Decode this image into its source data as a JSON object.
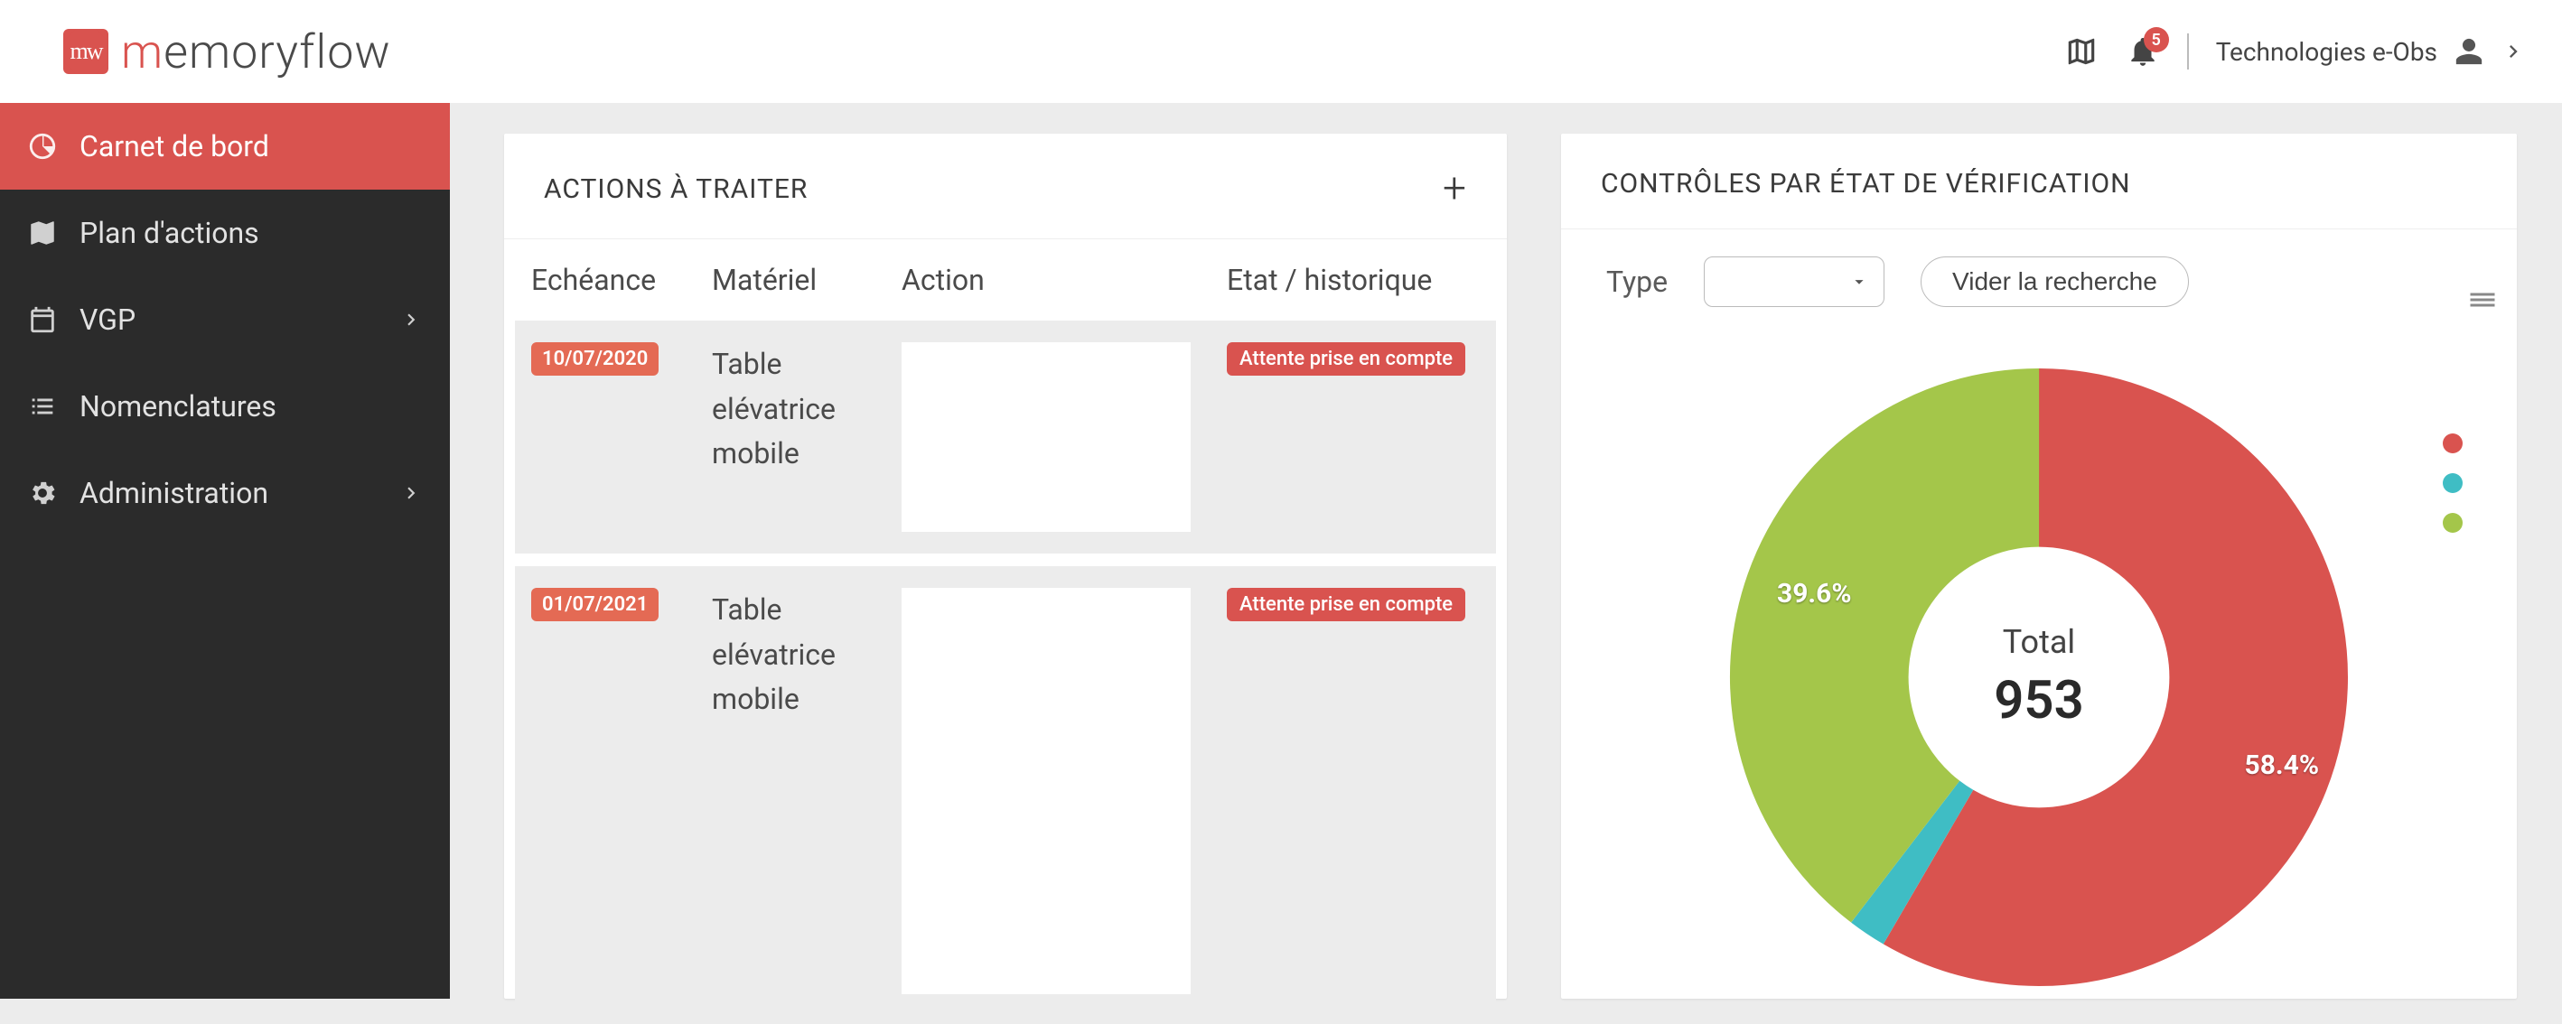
{
  "brand": {
    "name": "memoryflow",
    "badge_text": "mw"
  },
  "header": {
    "notif_count": "5",
    "account_label": "Technologies e-Obs"
  },
  "sidebar": {
    "items": [
      {
        "label": "Carnet de bord",
        "icon": "dashboard",
        "active": true
      },
      {
        "label": "Plan d'actions",
        "icon": "map"
      },
      {
        "label": "VGP",
        "icon": "calendar",
        "expandable": true
      },
      {
        "label": "Nomenclatures",
        "icon": "list"
      },
      {
        "label": "Administration",
        "icon": "gear",
        "expandable": true
      }
    ]
  },
  "actions_panel": {
    "title": "ACTIONS À TRAITER",
    "columns": {
      "c0": "Echéance",
      "c1": "Matériel",
      "c2": "Action",
      "c3": "Etat / historique"
    },
    "rows": [
      {
        "date": "10/07/2020",
        "materiel": "Table elévatrice mobile",
        "etat": "Attente prise en compte"
      },
      {
        "date": "01/07/2021",
        "materiel": "Table elévatrice mobile",
        "etat": "Attente prise en compte"
      }
    ]
  },
  "controls_panel": {
    "title": "CONTRÔLES PAR ÉTAT DE VÉRIFICATION",
    "type_label": "Type",
    "clear_label": "Vider la recherche",
    "total_label": "Total",
    "total_value": "953",
    "slice_labels": {
      "green": "39.6%",
      "red": "58.4%"
    }
  },
  "chart_data": {
    "type": "pie",
    "title": "CONTRÔLES PAR ÉTAT DE VÉRIFICATION",
    "total": 953,
    "series": [
      {
        "name": "red",
        "pct": 58.4,
        "value": 557,
        "color": "#d9534f"
      },
      {
        "name": "teal",
        "pct": 2.0,
        "value": 19,
        "color": "#3fbdc4"
      },
      {
        "name": "green",
        "pct": 39.6,
        "value": 377,
        "color": "#a4c64a"
      }
    ]
  },
  "colors": {
    "accent": "#d9534f",
    "green": "#a4c64a",
    "teal": "#3fbdc4"
  }
}
